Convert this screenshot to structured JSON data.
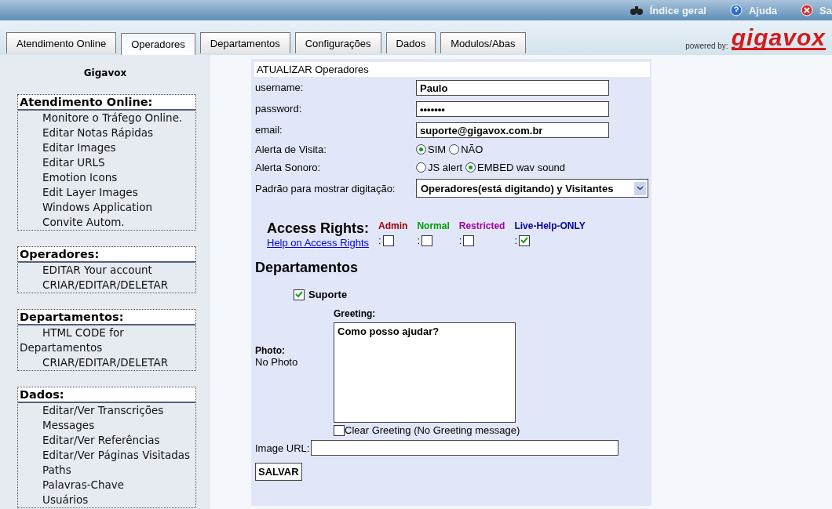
{
  "top_links": [
    {
      "label": "Índice geral",
      "kind": "search"
    },
    {
      "label": "Ajuda",
      "kind": "help"
    },
    {
      "label": "Sa",
      "kind": "exit"
    }
  ],
  "tabs": [
    {
      "label": "Atendimento Online",
      "selected": false
    },
    {
      "label": "Operadores",
      "selected": true
    },
    {
      "label": "Departamentos",
      "selected": false
    },
    {
      "label": "Configurações",
      "selected": false
    },
    {
      "label": "Dados",
      "selected": false
    },
    {
      "label": "Modulos/Abas",
      "selected": false
    }
  ],
  "powered_by": {
    "label": "powered by:",
    "logo": "gigavox"
  },
  "sidebar": {
    "title": "Gigavox",
    "groups": [
      {
        "title": "Atendimento Online:",
        "items": [
          "Monitore o Tráfego Online.",
          "Editar Notas Rápidas",
          "Editar Images",
          "Editar URLS",
          "Emotion Icons",
          "Edit Layer Images",
          "Windows Application",
          "Convite Autom."
        ]
      },
      {
        "title": "Operadores:",
        "items": [
          "EDITAR Your account",
          "CRIAR/EDITAR/DELETAR"
        ]
      },
      {
        "title": "Departamentos:",
        "items": [
          "HTML CODE for Departamentos",
          "CRIAR/EDITAR/DELETAR"
        ]
      },
      {
        "title": "Dados:",
        "items": [
          "Editar/Ver Transcrições",
          "Messages",
          "Editar/Ver Referências",
          "Editar/Ver Páginas Visitadas",
          "Paths",
          "Palavras-Chave",
          "Usuários"
        ]
      }
    ]
  },
  "form": {
    "title": "ATUALIZAR Operadores",
    "fields": [
      {
        "kind": "text",
        "label": "username:",
        "value": "Paulo"
      },
      {
        "kind": "text",
        "label": "password:",
        "value": "•••••••"
      },
      {
        "kind": "text",
        "label": "email:",
        "value": "suporte@gigavox.com.br"
      },
      {
        "kind": "radio",
        "label": "Alerta de Visita:",
        "options": [
          {
            "label": "SIM",
            "selected": true
          },
          {
            "label": "NÃO",
            "selected": false
          }
        ]
      },
      {
        "kind": "radio",
        "label": "Alerta Sonoro:",
        "options": [
          {
            "label": "JS alert",
            "selected": false
          },
          {
            "label": "EMBED wav sound",
            "selected": true
          }
        ]
      },
      {
        "kind": "select",
        "label": "Padrão para mostrar digitação:",
        "value": "Operadores(está digitando) y Visitantes"
      }
    ],
    "access_rights": {
      "title": "Access Rights:",
      "help_link": "Help on Access Rights",
      "levels": [
        {
          "label": "Admin",
          "color": "#a00000",
          "separator": ":",
          "checked": false
        },
        {
          "label": "Normal",
          "color": "#00a000",
          "separator": ":",
          "checked": false
        },
        {
          "label": "Restricted",
          "color": "#a000a0",
          "separator": ":",
          "checked": false
        },
        {
          "label": "Live-Help-ONLY",
          "color": "#0000a0",
          "separator": ":",
          "checked": true
        }
      ]
    },
    "departments": {
      "title": "Departamentos",
      "items": [
        {
          "name": "Suporte",
          "checked": true,
          "greeting_label": "Greeting:",
          "greeting": "Como posso ajudar?",
          "photo_label": "Photo:",
          "photo": "No Photo",
          "clear_label": "Clear Greeting (No Greeting message)",
          "clear_checked": false
        }
      ]
    },
    "image_url": {
      "label": "Image URL:"
    },
    "save_button": "SALVAR"
  }
}
